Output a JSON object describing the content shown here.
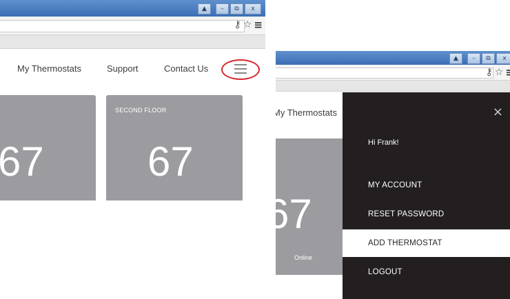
{
  "left": {
    "nav": [
      "My Thermostats",
      "Support",
      "Contact Us"
    ],
    "cards": [
      {
        "name": "",
        "temp": "67"
      },
      {
        "name": "SECOND FLOOR",
        "temp": "67"
      }
    ]
  },
  "right": {
    "nav_partial": "My Thermostats",
    "card": {
      "temp": "67",
      "status": "Online"
    },
    "drawer": {
      "close_glyph": "×",
      "greeting": "Hi Frank!",
      "items": [
        "MY ACCOUNT",
        "RESET PASSWORD",
        "ADD THERMOSTAT",
        "LOGOUT"
      ],
      "active_item": "ADD THERMOSTAT"
    }
  },
  "browser": {
    "window_buttons": [
      "▲",
      "–",
      "⧉",
      "x"
    ],
    "icons": [
      "key-icon",
      "star-icon",
      "menu-icon"
    ]
  },
  "colors": {
    "titlebar": "#3b6db3",
    "card": "#9c9b9f",
    "drawer": "#231f20",
    "highlight_ring": "#d8242a"
  }
}
